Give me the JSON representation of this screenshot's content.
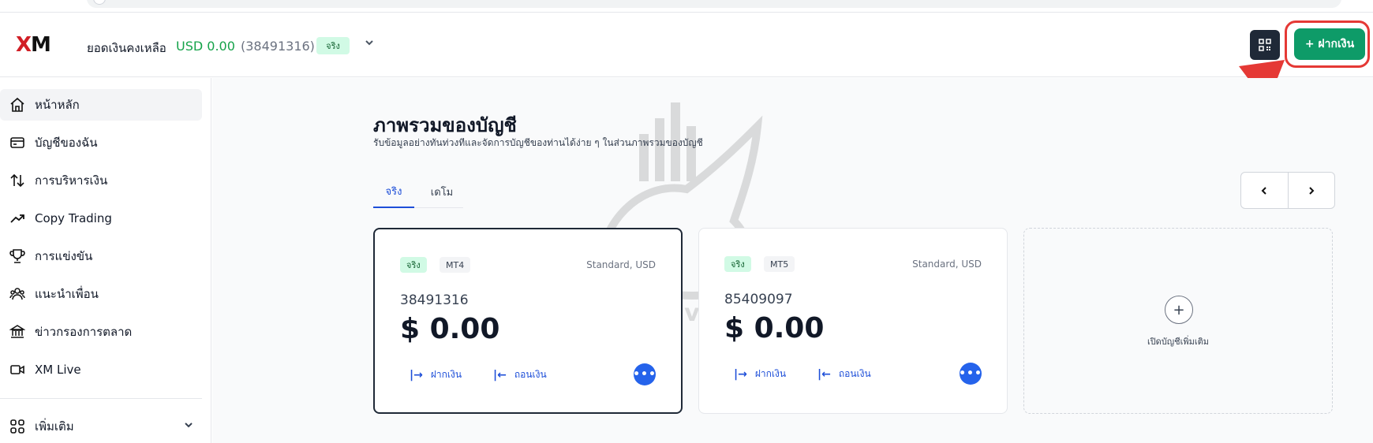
{
  "header": {
    "logo": "XM",
    "balance_label": "ยอดเงินคงเหลือ",
    "balance_amount": "USD 0.00",
    "account_id": "(38491316)",
    "account_badge": "จริง",
    "deposit_button": "+ ฝากเงิน",
    "icons": {
      "expand": "chevron-down-icon",
      "qr": "qr-code-icon"
    }
  },
  "sidebar": {
    "items": [
      {
        "label": "หน้าหลัก",
        "icon": "home-icon",
        "active": true
      },
      {
        "label": "บัญชีของฉัน",
        "icon": "card-icon"
      },
      {
        "label": "การบริหารเงิน",
        "icon": "transfer-icon"
      },
      {
        "label": "Copy Trading",
        "icon": "trend-up-icon"
      },
      {
        "label": "การแข่งขัน",
        "icon": "trophy-icon"
      },
      {
        "label": "แนะนำเพื่อน",
        "icon": "users-icon"
      },
      {
        "label": "ข่าวกรองการตลาด",
        "icon": "bank-icon"
      },
      {
        "label": "XM Live",
        "icon": "video-icon"
      }
    ],
    "more_label": "เพิ่มเติม"
  },
  "main": {
    "title": "ภาพรวมของบัญชี",
    "subtitle": "รับข้อมูลอย่างทันท่วงทีและจัดการบัญชีของท่านได้ง่าย ๆ ในส่วนภาพรวมของบัญชี",
    "tabs": [
      {
        "label": "จริง",
        "active": true
      },
      {
        "label": "เดโม"
      }
    ],
    "pager": {
      "prev": "‹",
      "next": "›"
    },
    "watermark_text": "FTT Investing",
    "accounts": [
      {
        "badge": "จริง",
        "platform": "MT4",
        "type": "Standard, USD",
        "number": "38491316",
        "balance": "$ 0.00",
        "deposit": "ฝากเงิน",
        "withdraw": "ถอนเงิน"
      },
      {
        "badge": "จริง",
        "platform": "MT5",
        "type": "Standard, USD",
        "number": "85409097",
        "balance": "$ 0.00",
        "deposit": "ฝากเงิน",
        "withdraw": "ถอนเงิน"
      }
    ],
    "add_account_label": "เปิดบัญชีเพิ่มเติม"
  },
  "colors": {
    "brand_red": "#d11f26",
    "accent_green": "#0e9b68",
    "link_blue": "#1d4ed8",
    "highlight_red": "#e53935"
  }
}
